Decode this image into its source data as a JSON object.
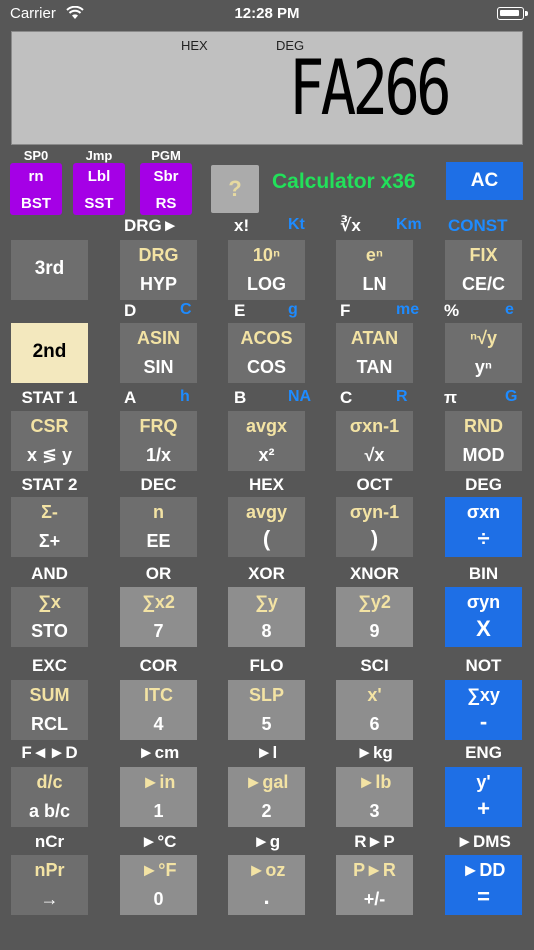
{
  "status": {
    "carrier": "Carrier",
    "time": "12:28 PM"
  },
  "display": {
    "hex": "HEX",
    "deg": "DEG",
    "value": "FA266"
  },
  "top": {
    "purple": [
      {
        "hdr": "SP0",
        "top": "rn",
        "bottom": "BST"
      },
      {
        "hdr": "Jmp",
        "top": "Lbl",
        "bottom": "SST"
      },
      {
        "hdr": "PGM",
        "top": "Sbr",
        "bottom": "RS"
      }
    ],
    "help": "?",
    "brand": "Calculator x36",
    "ac": "AC"
  },
  "rows": [
    {
      "labels": [
        "",
        "DRG►",
        "x!",
        "∛x",
        ""
      ],
      "alpha": [
        "",
        "",
        "Kt",
        "Km",
        "CONST"
      ],
      "keys": [
        {
          "k2": "",
          "k1": "3rd",
          "style": "dark"
        },
        {
          "k2": "DRG",
          "k1": "HYP",
          "style": "dark"
        },
        {
          "k2": "10ⁿ",
          "k1": "LOG",
          "style": "dark"
        },
        {
          "k2": "eⁿ",
          "k1": "LN",
          "style": "dark"
        },
        {
          "k2": "FIX",
          "k1": "CE/C",
          "style": "dark"
        }
      ]
    },
    {
      "labels": [
        "",
        "D",
        "E",
        "F",
        "%"
      ],
      "alpha": [
        "",
        "C",
        "g",
        "me",
        "e"
      ],
      "keys": [
        {
          "k2": "",
          "k1": "2nd",
          "style": "cream"
        },
        {
          "k2": "ASIN",
          "k1": "SIN",
          "style": "dark"
        },
        {
          "k2": "ACOS",
          "k1": "COS",
          "style": "dark"
        },
        {
          "k2": "ATAN",
          "k1": "TAN",
          "style": "dark"
        },
        {
          "k2": "ⁿ√y",
          "k1": "yⁿ",
          "style": "dark"
        }
      ]
    },
    {
      "labels": [
        "STAT 1",
        "A",
        "B",
        "C",
        "π"
      ],
      "alpha": [
        "",
        "h",
        "NA",
        "R",
        "G"
      ],
      "keys": [
        {
          "k2": "CSR",
          "k1": "x ≶ y",
          "style": "dark"
        },
        {
          "k2": "FRQ",
          "k1": "1/x",
          "style": "dark"
        },
        {
          "k2": "avgx",
          "k1": "x²",
          "style": "dark"
        },
        {
          "k2": "σxn-1",
          "k1": "√x",
          "style": "dark"
        },
        {
          "k2": "RND",
          "k1": "MOD",
          "style": "dark"
        }
      ]
    },
    {
      "labels": [
        "STAT 2",
        "DEC",
        "HEX",
        "OCT",
        "DEG"
      ],
      "alpha": [
        "",
        "",
        "",
        "",
        ""
      ],
      "keys": [
        {
          "k2": "Σ-",
          "k1": "Σ+",
          "style": "dark"
        },
        {
          "k2": "n",
          "k1": "EE",
          "style": "dark"
        },
        {
          "k2": "avgy",
          "k1": "(",
          "style": "dark"
        },
        {
          "k2": "σyn-1",
          "k1": ")",
          "style": "dark"
        },
        {
          "k2": "σxn",
          "k1": "÷",
          "style": "blue"
        }
      ]
    },
    {
      "labels": [
        "AND",
        "OR",
        "XOR",
        "XNOR",
        "BIN"
      ],
      "alpha": [
        "",
        "",
        "",
        "",
        ""
      ],
      "keys": [
        {
          "k2": "∑x",
          "k1": "STO",
          "style": "dark"
        },
        {
          "k2": "∑x2",
          "k1": "7",
          "style": "light"
        },
        {
          "k2": "∑y",
          "k1": "8",
          "style": "light"
        },
        {
          "k2": "∑y2",
          "k1": "9",
          "style": "light"
        },
        {
          "k2": "σyn",
          "k1": "X",
          "style": "blue"
        }
      ]
    },
    {
      "labels": [
        "EXC",
        "COR",
        "FLO",
        "SCI",
        "NOT"
      ],
      "alpha": [
        "",
        "",
        "",
        "",
        ""
      ],
      "keys": [
        {
          "k2": "SUM",
          "k1": "RCL",
          "style": "dark"
        },
        {
          "k2": "ITC",
          "k1": "4",
          "style": "light"
        },
        {
          "k2": "SLP",
          "k1": "5",
          "style": "light"
        },
        {
          "k2": "x'",
          "k1": "6",
          "style": "light"
        },
        {
          "k2": "∑xy",
          "k1": "-",
          "style": "blue"
        }
      ]
    },
    {
      "labels": [
        "F◄►D",
        "►cm",
        "►l",
        "►kg",
        "ENG"
      ],
      "alpha": [
        "",
        "",
        "",
        "",
        ""
      ],
      "keys": [
        {
          "k2": "d/c",
          "k1": "a b/c",
          "style": "dark"
        },
        {
          "k2": "►in",
          "k1": "1",
          "style": "light"
        },
        {
          "k2": "►gal",
          "k1": "2",
          "style": "light"
        },
        {
          "k2": "►lb",
          "k1": "3",
          "style": "light"
        },
        {
          "k2": "y'",
          "k1": "+",
          "style": "blue"
        }
      ]
    },
    {
      "labels": [
        "nCr",
        "►°C",
        "►g",
        "R►P",
        "►DMS"
      ],
      "alpha": [
        "",
        "",
        "",
        "",
        ""
      ],
      "keys": [
        {
          "k2": "nPr",
          "k1": "→",
          "style": "dark"
        },
        {
          "k2": "►°F",
          "k1": "0",
          "style": "light"
        },
        {
          "k2": "►oz",
          "k1": ".",
          "style": "light"
        },
        {
          "k2": "P►R",
          "k1": "+/-",
          "style": "light"
        },
        {
          "k2": "►DD",
          "k1": "=",
          "style": "blue"
        }
      ]
    }
  ]
}
